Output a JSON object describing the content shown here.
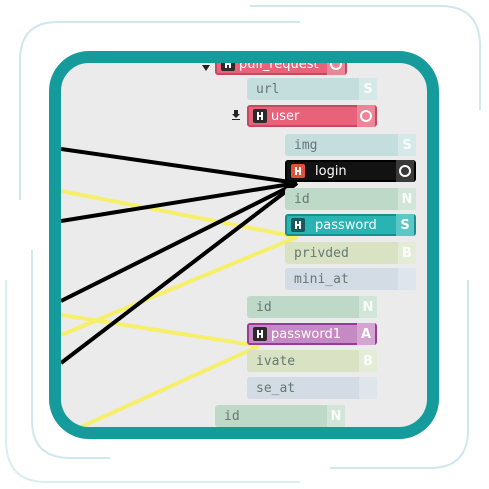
{
  "theme": {
    "frame_color": "#159b9b",
    "canvas_bg": "#ebebeb",
    "edge_black": "#000000",
    "edge_yellow": "#f5ef6a"
  },
  "nodes": {
    "pull_request": {
      "label": "pull_request",
      "type": "O",
      "icon": "key-icon"
    },
    "url": {
      "label": "url",
      "type": "S"
    },
    "user": {
      "label": "user",
      "type": "O",
      "icon": "key-icon"
    },
    "img": {
      "label": "img",
      "type": "S"
    },
    "login": {
      "label": "login",
      "type": "O",
      "icon": "key-icon"
    },
    "id": {
      "label": "id",
      "type": "N"
    },
    "password": {
      "label": "password",
      "type": "S",
      "icon": "key-icon"
    },
    "privded": {
      "label": "privded",
      "type": "B"
    },
    "mini_at": {
      "label": "mini_at",
      "type": ""
    },
    "id2": {
      "label": "id",
      "type": "N"
    },
    "password1": {
      "label": "password1",
      "type": "A",
      "icon": "key-icon"
    },
    "ivate": {
      "label": "ivate",
      "type": "B"
    },
    "se_at": {
      "label": "se_at",
      "type": ""
    },
    "id3": {
      "label": "id",
      "type": "N"
    }
  }
}
